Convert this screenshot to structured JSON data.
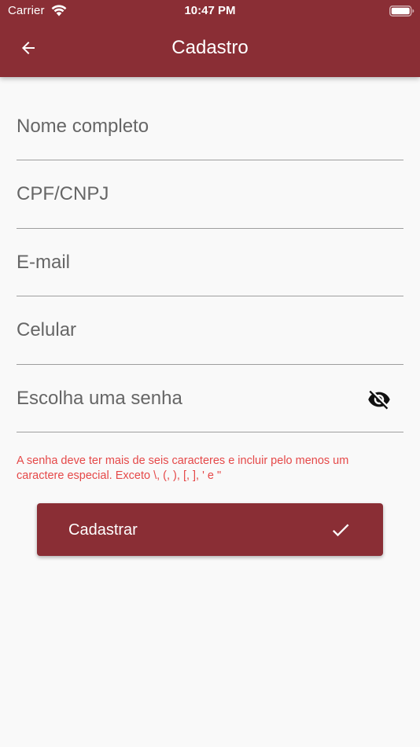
{
  "status_bar": {
    "carrier": "Carrier",
    "time": "10:47 PM"
  },
  "app_bar": {
    "title": "Cadastro",
    "back_icon": "arrow-left-icon"
  },
  "form": {
    "full_name": {
      "placeholder": "Nome completo",
      "value": ""
    },
    "cpf_cnpj": {
      "placeholder": "CPF/CNPJ",
      "value": ""
    },
    "email": {
      "placeholder": "E-mail",
      "value": ""
    },
    "phone": {
      "placeholder": "Celular",
      "value": ""
    },
    "password": {
      "placeholder": "Escolha uma senha",
      "value": "",
      "toggle_icon": "eye-off-icon"
    },
    "password_hint": "A senha deve ter mais de seis caracteres e incluir pelo menos um caractere especial. Exceto \\, (, ), [, ], ' e \""
  },
  "submit": {
    "label": "Cadastrar",
    "icon": "check-icon"
  },
  "colors": {
    "primary": "#8a2e35",
    "background": "#f9f9f9",
    "error": "#e54848",
    "divider": "#9e9e9e"
  }
}
